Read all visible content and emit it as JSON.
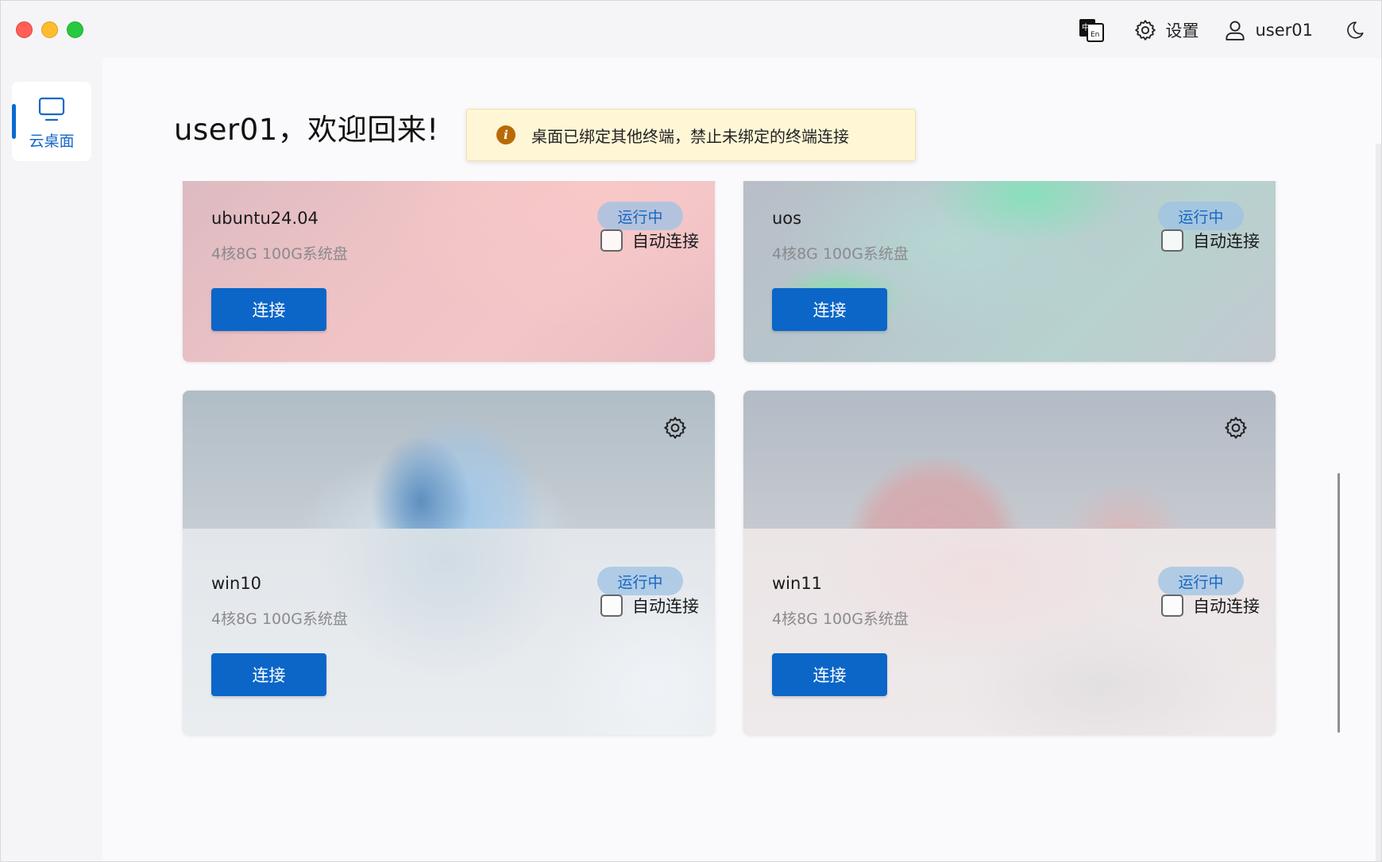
{
  "window": {
    "controls": [
      "close",
      "minimize",
      "maximize"
    ]
  },
  "topbar": {
    "language_icon": "zh-en-translate-icon",
    "settings_label": "设置",
    "username": "user01",
    "theme_icon": "moon-icon"
  },
  "sidebar": {
    "items": [
      {
        "label": "云桌面",
        "icon": "monitor-icon",
        "active": true
      }
    ]
  },
  "main": {
    "welcome": "user01，欢迎回来!",
    "notice": {
      "icon": "info-icon",
      "icon_glyph": "i",
      "text": "桌面已绑定其他终端，禁止未绑定的终端连接",
      "color": "#fff6d6"
    },
    "desktops": [
      {
        "name": "ubuntu24.04",
        "spec": "4核8G 100G系统盘",
        "status": "运行中",
        "auto_connect_label": "自动连接",
        "auto_connect": false,
        "connect_label": "连接",
        "has_settings": false
      },
      {
        "name": "uos",
        "spec": "4核8G 100G系统盘",
        "status": "运行中",
        "auto_connect_label": "自动连接",
        "auto_connect": false,
        "connect_label": "连接",
        "has_settings": false
      },
      {
        "name": "win10",
        "spec": "4核8G 100G系统盘",
        "status": "运行中",
        "auto_connect_label": "自动连接",
        "auto_connect": false,
        "connect_label": "连接",
        "has_settings": true
      },
      {
        "name": "win11",
        "spec": "4核8G 100G系统盘",
        "status": "运行中",
        "auto_connect_label": "自动连接",
        "auto_connect": false,
        "connect_label": "连接",
        "has_settings": true
      }
    ]
  },
  "colors": {
    "accent": "#0b66c8",
    "status_badge_text": "#1766c0",
    "notice_icon": "#b96a05"
  }
}
